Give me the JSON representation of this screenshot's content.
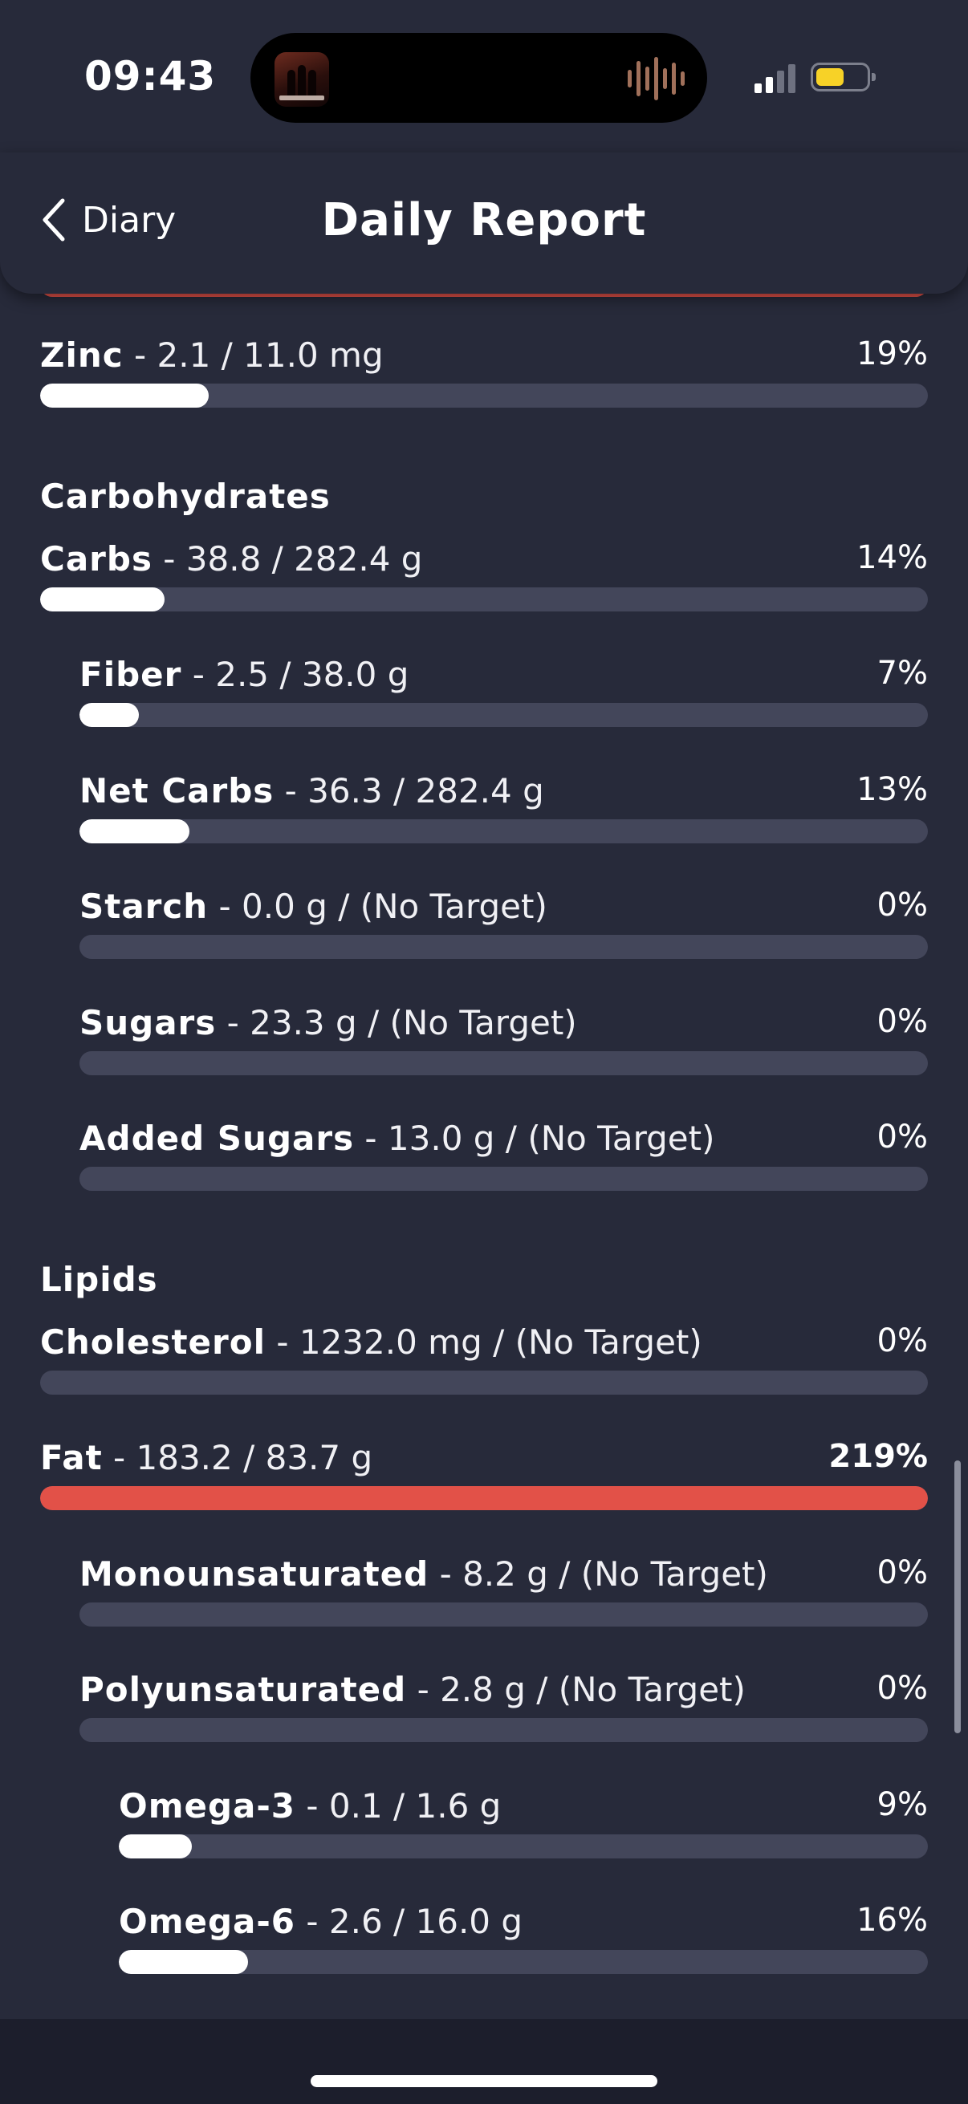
{
  "status_bar": {
    "time": "09:43",
    "now_playing_art_icon": "album-art-icon",
    "waveform_icon": "audio-waveform-icon",
    "signal_icon": "cellular-signal-icon",
    "battery_icon": "battery-icon",
    "battery_level": 0.55
  },
  "header": {
    "back_label": "Diary",
    "back_icon": "chevron-left-icon",
    "title": "Daily Report"
  },
  "colors": {
    "background": "#272a3a",
    "track": "#43465a",
    "progress": "#ffffff",
    "over_target": "#e25148",
    "battery": "#f7d227"
  },
  "minerals_tail": [
    {
      "name": "Zinc",
      "detail": " - 2.1 / 11.0 mg",
      "percent": "19%",
      "progress": 0.19,
      "over": false
    }
  ],
  "sections": {
    "carbohydrates": {
      "title": "Carbohydrates",
      "rows": [
        {
          "name": "Carbs",
          "detail": " - 38.8 / 282.4 g",
          "percent": "14%",
          "progress": 0.14,
          "over": false
        },
        {
          "name": "Fiber",
          "detail": " - 2.5 / 38.0 g",
          "percent": "7%",
          "progress": 0.07,
          "over": false
        },
        {
          "name": "Net Carbs",
          "detail": " - 36.3 / 282.4 g",
          "percent": "13%",
          "progress": 0.13,
          "over": false
        },
        {
          "name": "Starch",
          "detail": " - 0.0 g / (No Target)",
          "percent": "0%",
          "progress": 0,
          "over": false
        },
        {
          "name": "Sugars",
          "detail": " - 23.3 g / (No Target)",
          "percent": "0%",
          "progress": 0,
          "over": false
        },
        {
          "name": "Added Sugars",
          "detail": " - 13.0 g / (No Target)",
          "percent": "0%",
          "progress": 0,
          "over": false
        }
      ]
    },
    "lipids": {
      "title": "Lipids",
      "rows": [
        {
          "name": "Cholesterol",
          "detail": " - 1232.0 mg / (No Target)",
          "percent": "0%",
          "progress": 0,
          "over": false
        },
        {
          "name": "Fat",
          "detail": " - 183.2 / 83.7 g",
          "percent": "219%",
          "progress": 1,
          "over": true
        },
        {
          "name": "Monounsaturated",
          "detail": " - 8.2 g / (No Target)",
          "percent": "0%",
          "progress": 0,
          "over": false
        },
        {
          "name": "Polyunsaturated",
          "detail": " - 2.8 g / (No Target)",
          "percent": "0%",
          "progress": 0,
          "over": false
        },
        {
          "name": "Omega-3",
          "detail": " - 0.1 / 1.6 g",
          "percent": "9%",
          "progress": 0.09,
          "over": false
        },
        {
          "name": "Omega-6",
          "detail": " - 2.6 / 16.0 g",
          "percent": "16%",
          "progress": 0.16,
          "over": false
        }
      ]
    }
  }
}
